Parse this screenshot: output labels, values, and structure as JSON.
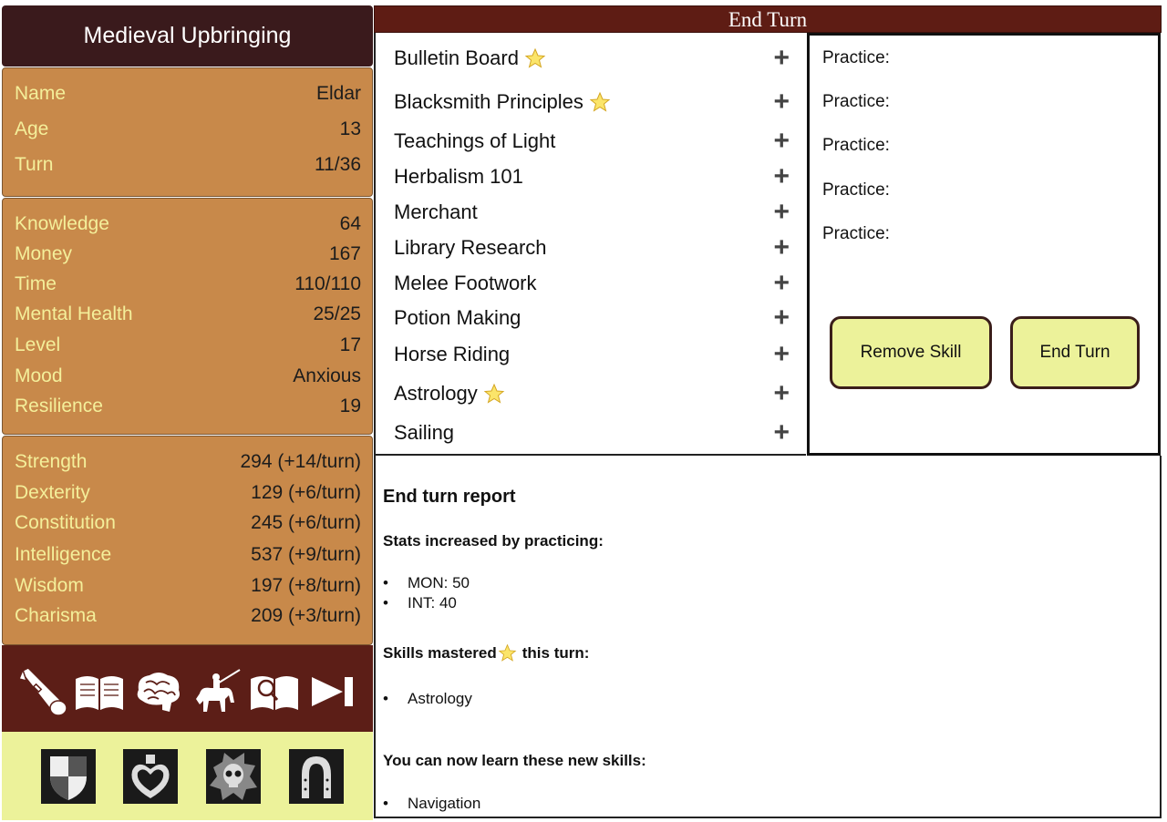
{
  "game_title": "Medieval Upbringing",
  "profile": [
    {
      "label": "Name",
      "value": "Eldar"
    },
    {
      "label": "Age",
      "value": "13"
    },
    {
      "label": "Turn",
      "value": "11/36"
    }
  ],
  "status": [
    {
      "label": "Knowledge",
      "value": "64"
    },
    {
      "label": "Money",
      "value": "167"
    },
    {
      "label": "Time",
      "value": "110/110"
    },
    {
      "label": "Mental Health",
      "value": "25/25"
    },
    {
      "label": "Level",
      "value": "17"
    },
    {
      "label": "Mood",
      "value": "Anxious"
    },
    {
      "label": "Resilience",
      "value": "19"
    }
  ],
  "attributes": [
    {
      "label": "Strength",
      "value": "294 (+14/turn)"
    },
    {
      "label": "Dexterity",
      "value": "129 (+6/turn)"
    },
    {
      "label": "Constitution",
      "value": "245 (+6/turn)"
    },
    {
      "label": "Intelligence",
      "value": "537 (+9/turn)"
    },
    {
      "label": "Wisdom",
      "value": "197 (+8/turn)"
    },
    {
      "label": "Charisma",
      "value": "209 (+3/turn)"
    }
  ],
  "nav_icons": [
    "telescope-icon",
    "open-book-icon",
    "brain-icon",
    "knight-on-horse-icon",
    "magnified-book-icon",
    "skip-forward-icon"
  ],
  "tray_icons": [
    "shield-icon",
    "heart-potion-icon",
    "skull-explosion-icon",
    "horseshoe-icon"
  ],
  "end_turn_header": "End Turn",
  "skills": [
    {
      "name": "Bulletin Board",
      "mastered": true
    },
    {
      "name": "Blacksmith Principles",
      "mastered": true
    },
    {
      "name": "Teachings of Light",
      "mastered": false
    },
    {
      "name": "Herbalism 101",
      "mastered": false
    },
    {
      "name": "Merchant",
      "mastered": false
    },
    {
      "name": "Library Research",
      "mastered": false
    },
    {
      "name": "Melee Footwork",
      "mastered": false
    },
    {
      "name": "Potion Making",
      "mastered": false
    },
    {
      "name": "Horse Riding",
      "mastered": false
    },
    {
      "name": "Astrology",
      "mastered": true
    },
    {
      "name": "Sailing",
      "mastered": false
    }
  ],
  "add_symbol": "+",
  "practice_slots": [
    "Practice:",
    "Practice:",
    "Practice:",
    "Practice:",
    "Practice:"
  ],
  "buttons": {
    "remove_skill": "Remove Skill",
    "end_turn": "End Turn"
  },
  "report": {
    "title": "End turn report",
    "stats_heading": "Stats increased by practicing:",
    "stats": [
      "MON: 50",
      "INT: 40"
    ],
    "mastered_heading_pre": "Skills mastered",
    "mastered_heading_post": "this turn:",
    "mastered": [
      "Astrology"
    ],
    "new_heading": "You can now learn these new skills:",
    "new_skills": [
      "Navigation"
    ]
  },
  "colors": {
    "dark_brown": "#3a1a1c",
    "panel_orange": "#c8894a",
    "label_yellow": "#f4ef9a",
    "maroon": "#5e1c14",
    "pale_yellow": "#ecf29a"
  }
}
